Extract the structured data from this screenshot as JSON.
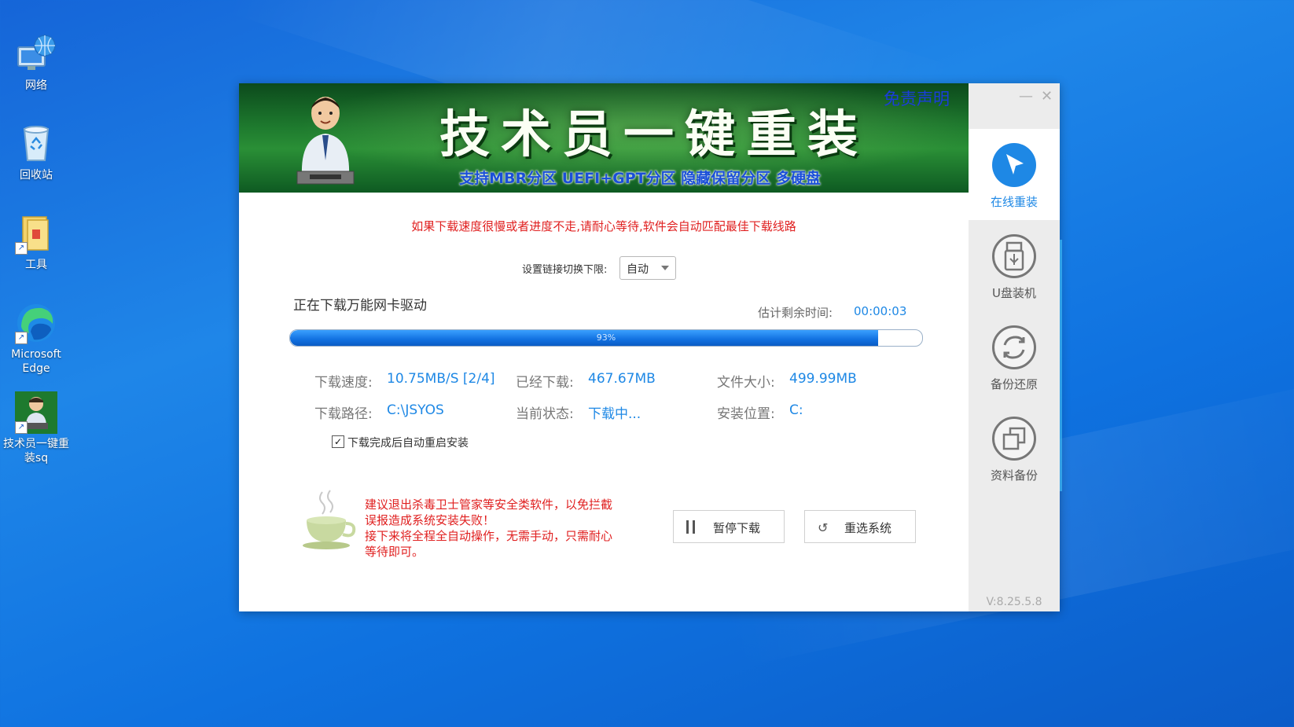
{
  "desktop": {
    "icons": [
      {
        "label": "网络"
      },
      {
        "label": "回收站"
      },
      {
        "label": "工具"
      },
      {
        "label": "Microsoft Edge"
      },
      {
        "label": "技术员一键重装sq"
      }
    ]
  },
  "window": {
    "banner": {
      "title": "技术员一键重装",
      "subtitle": "支持MBR分区 UEFI+GPT分区 隐藏保留分区 多硬盘",
      "disclaimer": "免责声明"
    },
    "notice": "如果下载速度很慢或者进度不走,请耐心等待,软件会自动匹配最佳下载线路",
    "link_switch": {
      "label": "设置链接切换下限:",
      "value": "自动"
    },
    "task": "正在下载万能网卡驱动",
    "eta": {
      "label": "估计剩余时间:",
      "value": "00:00:03"
    },
    "progress": {
      "percent": 93,
      "text": "93%"
    },
    "info": {
      "speed_label": "下载速度:",
      "speed": "10.75MB/S [2/4]",
      "downloaded_label": "已经下载:",
      "downloaded": "467.67MB",
      "size_label": "文件大小:",
      "size": "499.99MB",
      "path_label": "下载路径:",
      "path": "C:\\JSYOS",
      "status_label": "当前状态:",
      "status": "下载中...",
      "install_label": "安装位置:",
      "install": "C:"
    },
    "auto_restart": {
      "label": "下载完成后自动重启安装",
      "checked": true
    },
    "tips": {
      "line1": "建议退出杀毒卫士管家等安全类软件，以免拦截",
      "line2": "误报造成系统安装失败！",
      "line3": "接下来将全程全自动操作，无需手动，只需耐心",
      "line4": "等待即可。"
    },
    "buttons": {
      "pause": "暂停下载",
      "reselect": "重选系统"
    },
    "sidebar": {
      "items": [
        {
          "label": "在线重装",
          "icon": "cursor-arrow-icon",
          "active": true
        },
        {
          "label": "U盘装机",
          "icon": "usb-icon",
          "active": false
        },
        {
          "label": "备份还原",
          "icon": "sync-icon",
          "active": false
        },
        {
          "label": "资料备份",
          "icon": "copy-icon",
          "active": false
        }
      ],
      "version": "V:8.25.5.8"
    },
    "controls": {
      "minimize": "—",
      "close": "✕"
    },
    "colors": {
      "accent": "#1e88e5",
      "warning": "#e02020",
      "banner_green": "#1e7a2e"
    }
  }
}
